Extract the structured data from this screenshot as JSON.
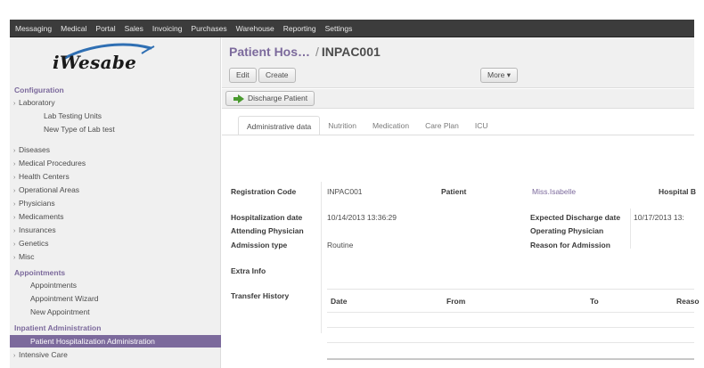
{
  "topbar": {
    "menu": [
      "Messaging",
      "Medical",
      "Portal",
      "Sales",
      "Invoicing",
      "Purchases",
      "Warehouse",
      "Reporting",
      "Settings"
    ]
  },
  "sidebar": {
    "logo_text": "iWesabe",
    "configuration": {
      "title": "Configuration",
      "laboratory": "Laboratory",
      "lab_testing_units": "Lab Testing Units",
      "new_type_lab_test": "New Type of Lab test",
      "items": [
        "Diseases",
        "Medical Procedures",
        "Health Centers",
        "Operational Areas",
        "Physicians",
        "Medicaments",
        "Insurances",
        "Genetics",
        "Misc"
      ]
    },
    "appointments": {
      "title": "Appointments",
      "items": [
        "Appointments",
        "Appointment Wizard",
        "New Appointment"
      ]
    },
    "inpatient": {
      "title": "Inpatient Administration",
      "selected": "Patient Hospitalization Administration",
      "intensive_care": "Intensive Care"
    }
  },
  "header": {
    "breadcrumb_link": "Patient Hos…",
    "breadcrumb_sep": "/",
    "breadcrumb_current": "INPAC001",
    "edit_label": "Edit",
    "create_label": "Create",
    "more_label": "More ▾"
  },
  "statusbar": {
    "discharge_label": "Discharge Patient"
  },
  "tabs": [
    "Administrative data",
    "Nutrition",
    "Medication",
    "Care Plan",
    "ICU"
  ],
  "form": {
    "registration_code_label": "Registration Code",
    "registration_code_value": "INPAC001",
    "patient_label": "Patient",
    "patient_value": "Miss.Isabelle",
    "hospital_bed_label": "Hospital B",
    "hospitalization_date_label": "Hospitalization date",
    "hospitalization_date_value": "10/14/2013 13:36:29",
    "expected_discharge_label": "Expected Discharge date",
    "expected_discharge_value": "10/17/2013 13:",
    "attending_physician_label": "Attending Physician",
    "operating_physician_label": "Operating Physician",
    "admission_type_label": "Admission type",
    "admission_type_value": "Routine",
    "reason_label": "Reason for Admission",
    "extra_info_label": "Extra Info",
    "transfer_history_label": "Transfer History"
  },
  "transfer_table": {
    "columns": [
      "Date",
      "From",
      "To",
      "Reaso"
    ]
  },
  "colors": {
    "accent": "#7c6a9c",
    "topbar": "#3c3c3c",
    "sidebar_bg": "#f0f0f0",
    "discharge_arrow": "#4a9a2f"
  }
}
